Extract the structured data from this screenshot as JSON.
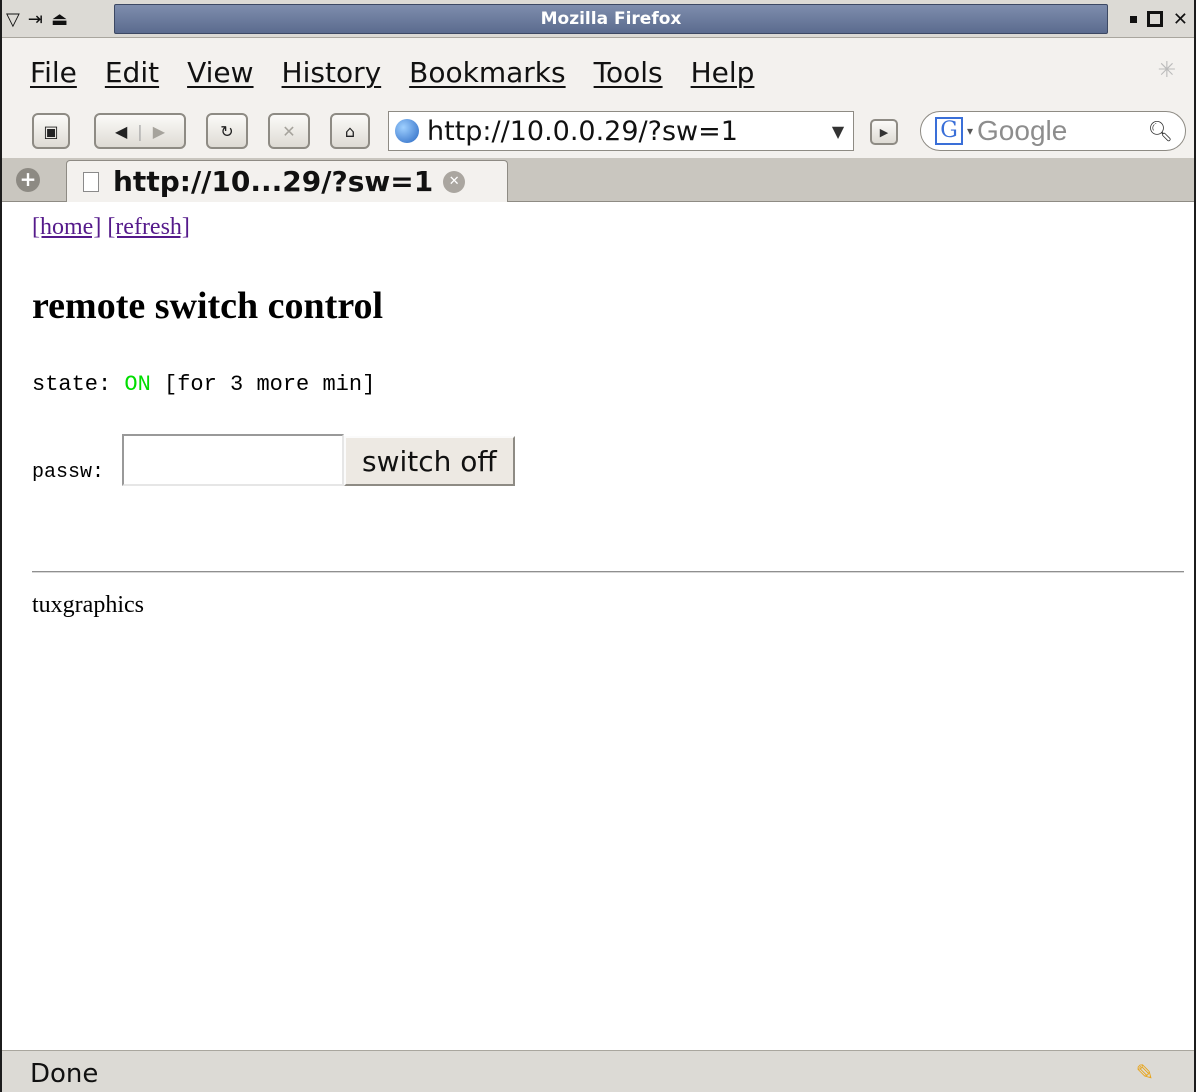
{
  "window": {
    "title": "Mozilla Firefox"
  },
  "menubar": {
    "items": [
      "File",
      "Edit",
      "View",
      "History",
      "Bookmarks",
      "Tools",
      "Help"
    ]
  },
  "navbar": {
    "url": "http://10.0.0.29/?sw=1",
    "search_engine": "Google",
    "icons": [
      "new-window-icon",
      "back-icon",
      "forward-icon",
      "reload-icon",
      "stop-icon",
      "home-icon",
      "globe-icon",
      "go-icon",
      "google-icon",
      "magnifier-icon"
    ]
  },
  "tabs": [
    {
      "label": "http://10...29/?sw=1"
    }
  ],
  "page": {
    "links": [
      "[home]",
      "[refresh]"
    ],
    "heading": "remote switch control",
    "state_label": "state:",
    "state_value": "ON",
    "state_suffix": "[for 3 more min]",
    "passw_label": "passw:",
    "password_value": "",
    "button_label": "switch off",
    "footer": "tuxgraphics",
    "colors": {
      "state_on": "#00dd00",
      "link": "#551a8b"
    }
  },
  "statusbar": {
    "text": "Done"
  }
}
